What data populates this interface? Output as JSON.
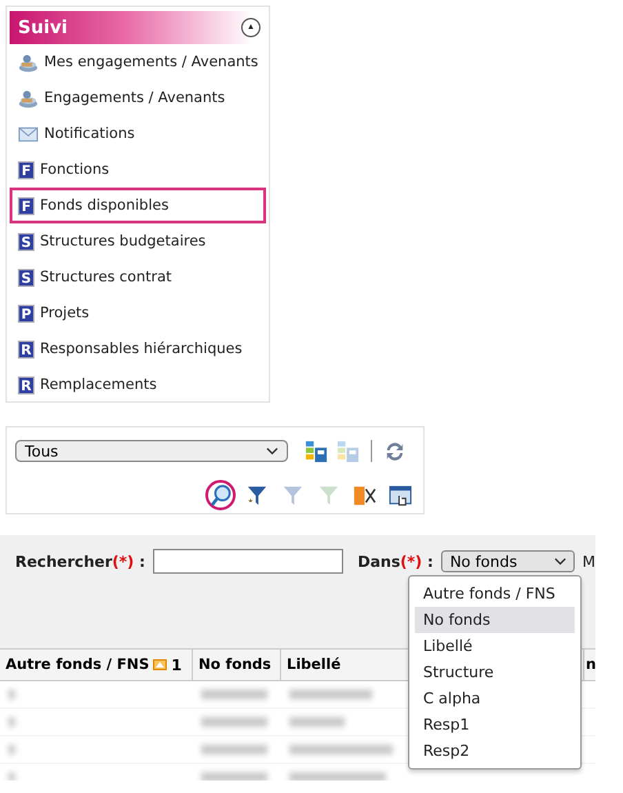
{
  "menu": {
    "title": "Suivi",
    "collapse_icon": "▲",
    "items": [
      {
        "label": "Mes engagements / Avenants",
        "kind": "stack",
        "highlighted": false
      },
      {
        "label": "Engagements / Avenants",
        "kind": "stack",
        "highlighted": false
      },
      {
        "label": "Notifications",
        "kind": "mail",
        "highlighted": false
      },
      {
        "label": "Fonctions",
        "kind": "letter",
        "badge": "F",
        "highlighted": false
      },
      {
        "label": "Fonds disponibles",
        "kind": "letter",
        "badge": "F",
        "highlighted": true
      },
      {
        "label": "Structures budgetaires",
        "kind": "letter",
        "badge": "S",
        "highlighted": false
      },
      {
        "label": "Structures contrat",
        "kind": "letter",
        "badge": "S",
        "highlighted": false
      },
      {
        "label": "Projets",
        "kind": "letter",
        "badge": "P",
        "highlighted": false
      },
      {
        "label": "Responsables hiérarchiques",
        "kind": "letter",
        "badge": "R",
        "highlighted": false
      },
      {
        "label": "Remplacements",
        "kind": "letter",
        "badge": "R",
        "highlighted": false
      }
    ]
  },
  "toolbar": {
    "select_value": "Tous",
    "top_tools": [
      {
        "kind": "grid-save",
        "disabled": false
      },
      {
        "kind": "grid-edit",
        "disabled": true
      },
      {
        "kind": "divider"
      },
      {
        "kind": "refresh",
        "disabled": false
      }
    ],
    "bottom_tools": [
      {
        "kind": "search",
        "disabled": false,
        "highlighted": true
      },
      {
        "kind": "filter-star",
        "disabled": false,
        "highlighted": false
      },
      {
        "kind": "filter-clear",
        "disabled": true,
        "highlighted": false
      },
      {
        "kind": "filter-green",
        "disabled": true,
        "highlighted": false
      },
      {
        "kind": "cut-orange",
        "disabled": false,
        "highlighted": false
      },
      {
        "kind": "calendar-hand",
        "disabled": false,
        "highlighted": false
      }
    ]
  },
  "search": {
    "label": "Rechercher",
    "required": "(*)",
    "separator": ":",
    "in_label": "Dans",
    "in_required": "(*)",
    "in_value": "No fonds",
    "cut_label": "M",
    "options": [
      {
        "label": "Autre fonds / FNS",
        "selected": false
      },
      {
        "label": "No fonds",
        "selected": true
      },
      {
        "label": "Libellé",
        "selected": false
      },
      {
        "label": "Structure",
        "selected": false
      },
      {
        "label": "C alpha",
        "selected": false
      },
      {
        "label": "Resp1",
        "selected": false
      },
      {
        "label": "Resp2",
        "selected": false
      }
    ]
  },
  "table": {
    "columns": [
      {
        "label": "Autre fonds / FNS",
        "sort_rank": "1"
      },
      {
        "label": "No fonds"
      },
      {
        "label": "Libellé"
      },
      {
        "label": "n"
      }
    ]
  }
}
